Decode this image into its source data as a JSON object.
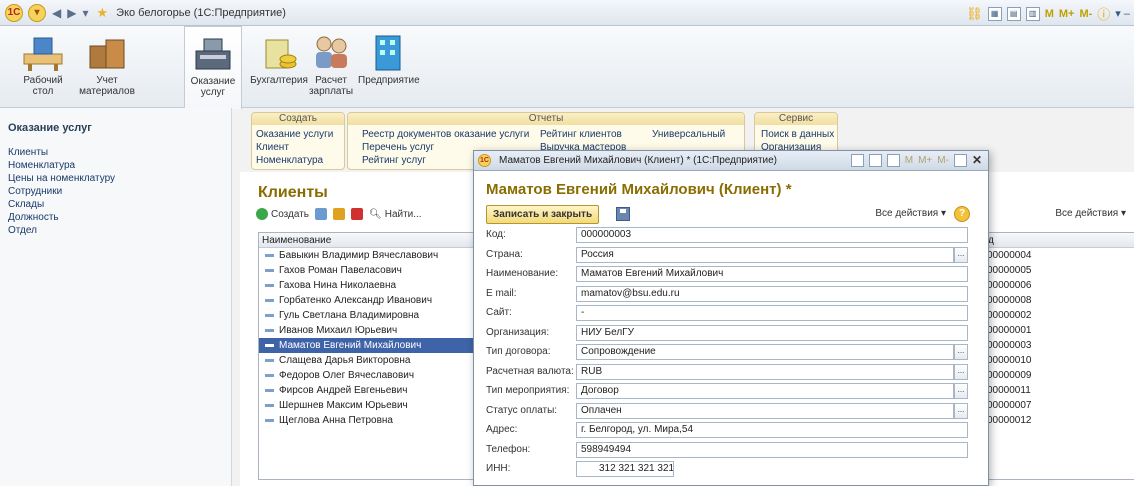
{
  "window": {
    "title": "Эко белогорье (1С:Предприятие)",
    "right_controls": [
      "M",
      "M+",
      "M-"
    ]
  },
  "sections": [
    {
      "label": "Рабочий стол",
      "icon": "desk-icon"
    },
    {
      "label": "Учет материалов",
      "icon": "boxes-icon"
    },
    {
      "label": "Оказание услуг",
      "icon": "cash-register-icon"
    },
    {
      "label": "Бухгалтерия",
      "icon": "coins-icon"
    },
    {
      "label": "Расчет зарплаты",
      "icon": "people-icon"
    },
    {
      "label": "Предприятие",
      "icon": "building-icon"
    }
  ],
  "leftnav": {
    "title": "Оказание услуг",
    "items": [
      "Клиенты",
      "Номенклатура",
      "Цены на номенклатуру",
      "Сотрудники",
      "Склады",
      "Должность",
      "Отдел"
    ]
  },
  "commands": {
    "create": {
      "header": "Создать",
      "items": [
        "Оказание услуги",
        "Клиент",
        "Номенклатура"
      ]
    },
    "reports": {
      "header": "Отчеты",
      "col1": [
        "Реестр документов оказание услуги",
        "Перечень услуг",
        "Рейтинг услуг"
      ],
      "col2": [
        "Рейтинг клиентов",
        "Выручка мастеров"
      ],
      "col3": [
        "Универсальный"
      ]
    },
    "service": {
      "header": "Сервис",
      "items": [
        "Поиск в данных",
        "Организация"
      ]
    }
  },
  "list": {
    "title": "Клиенты",
    "toolbar": {
      "create": "Создать",
      "find": "Найти...",
      "all_actions": "Все действия ▾"
    },
    "column": "Наименование",
    "code_column": "д",
    "rows": [
      "Бавыкин Владимир Вячеславович",
      "Гахов Роман Павеласович",
      "Гахова Нина Николаевна",
      "Горбатенко Александр Иванович",
      "Гуль Светлана Владимировна",
      "Иванов Михаил Юрьевич",
      "Маматов Евгений Михайлович",
      "Слащева Дарья Викторовна",
      "Федоров Олег Вячеславович",
      "Фирсов Андрей Евгеньевич",
      "Шершнев Максим Юрьевич",
      "Щеглова Анна Петровна"
    ],
    "codes": [
      "00000004",
      "00000005",
      "00000006",
      "00000008",
      "00000002",
      "00000001",
      "00000003",
      "00000010",
      "00000009",
      "00000011",
      "00000007",
      "00000012"
    ],
    "selected_index": 6
  },
  "dialog": {
    "window_title": "Маматов Евгений Михайлович (Клиент) * (1С:Предприятие)",
    "header": "Маматов Евгений Михайлович (Клиент) *",
    "save_close": "Записать и закрыть",
    "all_actions": "Все действия ▾",
    "help": "?",
    "title_controls": [
      "M",
      "M+",
      "M-"
    ],
    "fields": [
      {
        "label": "Код:",
        "value": "000000003",
        "dropdown": false
      },
      {
        "label": "Страна:",
        "value": "Россия",
        "dropdown": true
      },
      {
        "label": "Наименование:",
        "value": "Маматов Евгений Михайлович",
        "dropdown": false
      },
      {
        "label": "E mail:",
        "value": "mamatov@bsu.edu.ru",
        "dropdown": false
      },
      {
        "label": "Сайт:",
        "value": "-",
        "dropdown": false
      },
      {
        "label": "Организация:",
        "value": "НИУ БелГУ",
        "dropdown": false
      },
      {
        "label": "Тип договора:",
        "value": "Сопровождение",
        "dropdown": true
      },
      {
        "label": "Расчетная валюта:",
        "value": "RUB",
        "dropdown": true
      },
      {
        "label": "Тип мероприятия:",
        "value": "Договор",
        "dropdown": true
      },
      {
        "label": "Статус оплаты:",
        "value": "Оплачен",
        "dropdown": true
      },
      {
        "label": "Адрес:",
        "value": "г. Белгород, ул. Мира,54",
        "dropdown": false
      },
      {
        "label": "Телефон:",
        "value": "598949494",
        "dropdown": false
      },
      {
        "label": "ИНН:",
        "value": "312 321 321 321",
        "dropdown": false
      }
    ]
  },
  "colors": {
    "accent_gold": "#8a6d00",
    "selection": "#3f63a8",
    "link": "#1a3a6a"
  }
}
